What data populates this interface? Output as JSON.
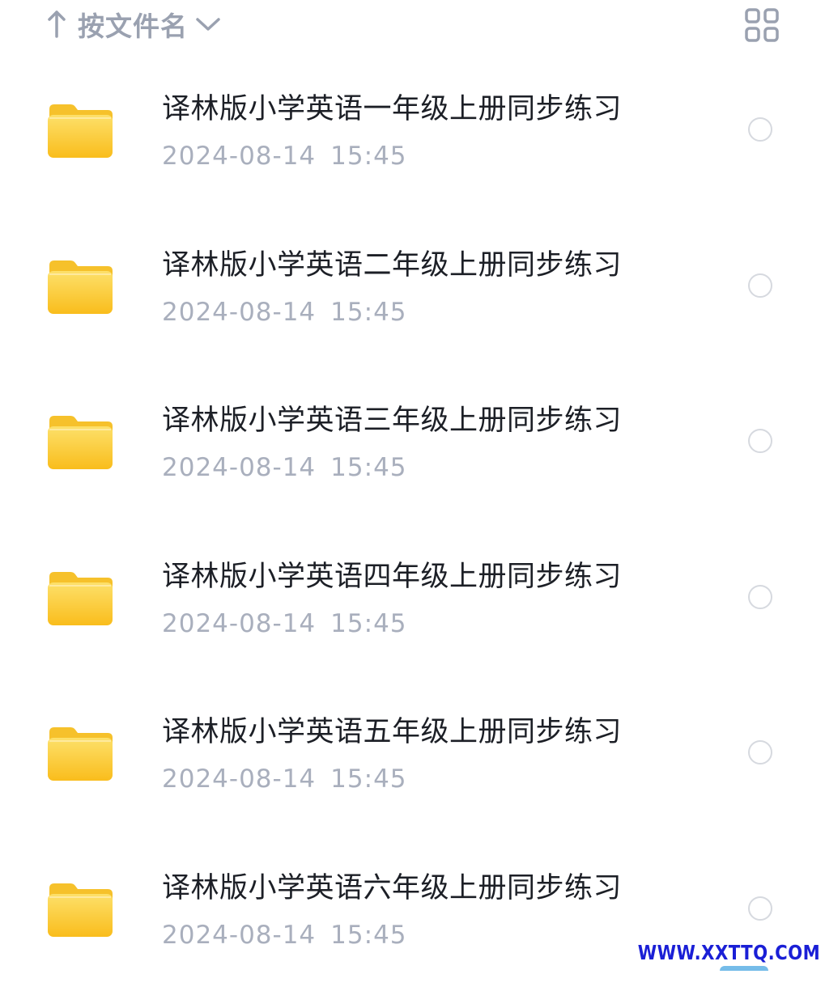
{
  "sort": {
    "label": "按文件名",
    "direction_icon": "arrow-up-icon",
    "dropdown_icon": "chevron-down-icon"
  },
  "view_toggle": {
    "icon": "grid-view-icon"
  },
  "files": [
    {
      "name": "译林版小学英语一年级上册同步练习",
      "date": "2024-08-14",
      "time": "15:45",
      "type": "folder"
    },
    {
      "name": "译林版小学英语二年级上册同步练习",
      "date": "2024-08-14",
      "time": "15:45",
      "type": "folder"
    },
    {
      "name": "译林版小学英语三年级上册同步练习",
      "date": "2024-08-14",
      "time": "15:45",
      "type": "folder"
    },
    {
      "name": "译林版小学英语四年级上册同步练习",
      "date": "2024-08-14",
      "time": "15:45",
      "type": "folder"
    },
    {
      "name": "译林版小学英语五年级上册同步练习",
      "date": "2024-08-14",
      "time": "15:45",
      "type": "folder"
    },
    {
      "name": "译林版小学英语六年级上册同步练习",
      "date": "2024-08-14",
      "time": "15:45",
      "type": "folder"
    }
  ],
  "watermark": "WWW.XXTTQ.COM",
  "colors": {
    "folder_top": "#fdd74a",
    "folder_bottom": "#f9bf1f",
    "text_primary": "#1c1f26",
    "text_secondary": "#a9afbd",
    "icon_gray": "#9aa1b0",
    "watermark": "#1a1fd6"
  }
}
